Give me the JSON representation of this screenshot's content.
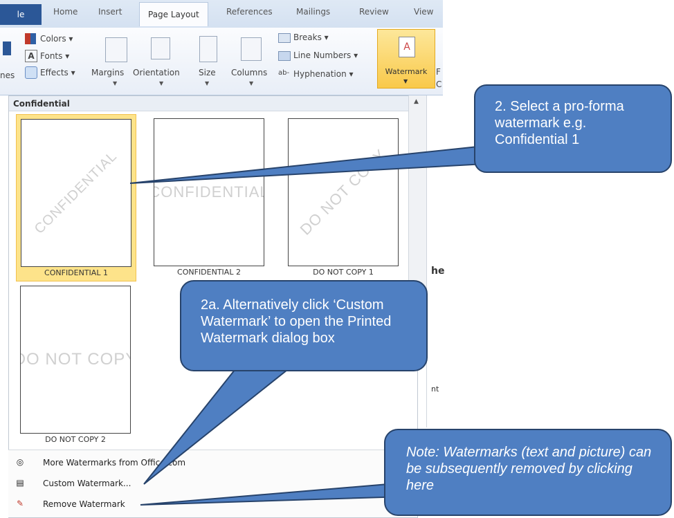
{
  "tabs": {
    "file": "le",
    "items": [
      "Home",
      "Insert",
      "Page Layout",
      "References",
      "Mailings",
      "Review",
      "View"
    ],
    "active": "Page Layout"
  },
  "ribbon": {
    "themes_label": "nes",
    "colors": "Colors ▾",
    "fonts": "Fonts ▾",
    "effects": "Effects ▾",
    "margins": "Margins",
    "orientation": "Orientation",
    "size": "Size",
    "columns": "Columns",
    "breaks": "Breaks ▾",
    "line_numbers": "Line Numbers ▾",
    "hyphenation": "Hyphenation ▾",
    "watermark": "Watermark",
    "cut_r": "F",
    "cut_c": "C"
  },
  "gallery": {
    "header": "Confidential",
    "items": [
      {
        "label": "CONFIDENTIAL 1",
        "text": "CONFIDENTIAL"
      },
      {
        "label": "CONFIDENTIAL 2",
        "text": "CONFIDENTIAL"
      },
      {
        "label": "DO NOT COPY 1",
        "text": "DO NOT COPY"
      },
      {
        "label": "DO NOT COPY 2",
        "text": "DO NOT COPY"
      }
    ]
  },
  "menu": {
    "more": "More Watermarks from Office.com",
    "custom": "Custom Watermark...",
    "remove": "Remove Watermark"
  },
  "doc_snippets": {
    "d1": "he",
    "d2": "nt"
  },
  "callouts": {
    "c1": "2. Select a pro-forma watermark e.g. Confidential 1",
    "c2": "2a. Alternatively click ‘Custom Watermark’ to open the Printed Watermark dialog box",
    "c3": "Note: Watermarks (text and picture) can be subsequently removed by clicking here"
  },
  "colors": {
    "callout_fill": "#4f7fc2",
    "callout_border": "#27436b",
    "selected": "#fde38a"
  }
}
